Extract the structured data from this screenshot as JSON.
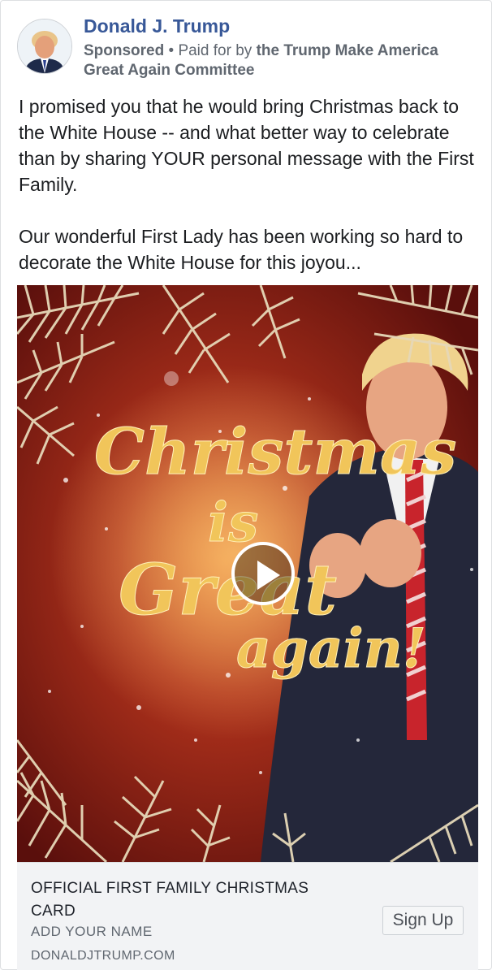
{
  "post": {
    "author": "Donald J. Trump",
    "sponsored_label": "Sponsored",
    "paid_for_prefix": " • Paid for by ",
    "paid_for_org": "the Trump Make America Great Again Committee",
    "text_paragraph_1": "I promised you that he would bring Christmas back to the White House -- and what better way to celebrate than by sharing YOUR personal message with the First Family.",
    "text_paragraph_2": "Our wonderful First Lady has been working so hard to decorate the White House for this joyou..."
  },
  "media": {
    "overlay_text": [
      "Christmas",
      "is",
      "Great",
      "again!"
    ],
    "play_icon": "play-icon",
    "colors": {
      "background": "#7a1a14",
      "gold": "#f1c55a",
      "branch": "#e6d8b8"
    }
  },
  "link_preview": {
    "title": "OFFICIAL FIRST FAMILY CHRISTMAS CARD",
    "description": "ADD YOUR NAME",
    "domain": "DONALDJTRUMP.COM",
    "cta_label": "Sign Up"
  }
}
